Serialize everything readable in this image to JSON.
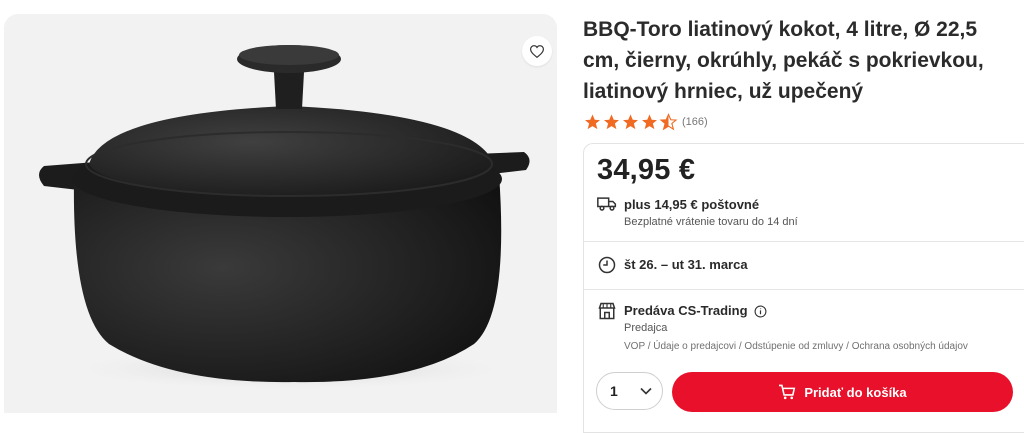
{
  "product": {
    "title": "BBQ-Toro liatinový kokot, 4 litre, Ø 22,5 cm, čierny, okrúhly, pekáč s pokrievkou, liatinový hrniec, už upečený",
    "rating_stars": 4.5,
    "rating_count": "(166)",
    "price": "34,95 €"
  },
  "shipping": {
    "label": "plus 14,95 € poštovné",
    "returns": "Bezplatné vrátenie tovaru do 14 dní"
  },
  "delivery": {
    "dates": "št 26. – ut 31. marca"
  },
  "seller": {
    "label": "Predáva CS-Trading",
    "type": "Predajca",
    "links": "VOP / Údaje o predajcovi / Odstúpenie od zmluvy / Ochrana osobných údajov"
  },
  "cart": {
    "quantity": "1",
    "button_label": "Pridať do košíka"
  },
  "icons": {
    "favorite": "heart-icon",
    "shipping": "truck-icon",
    "delivery": "clock-icon",
    "seller": "store-icon",
    "info": "info-icon",
    "quantity": "chevron-down-icon",
    "cart": "cart-icon",
    "rating": "star-icon"
  },
  "colors": {
    "accent": "#e8102a",
    "star": "#f06a22"
  }
}
